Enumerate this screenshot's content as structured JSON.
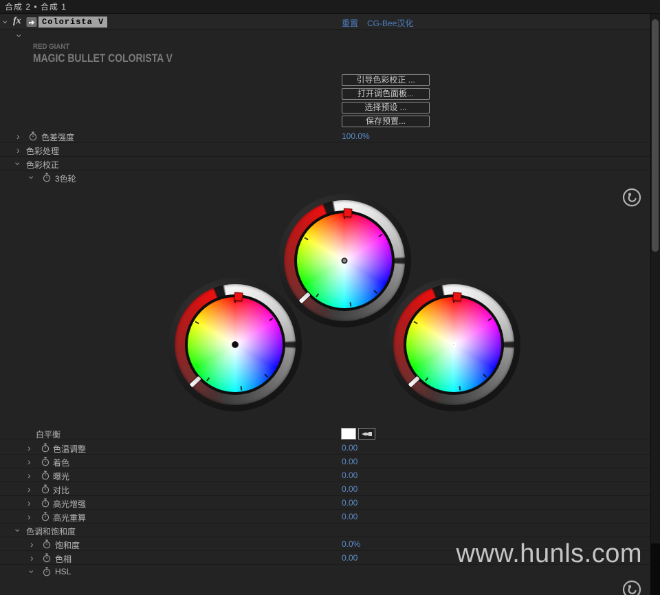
{
  "colors": {
    "accent_blue": "#5d8cc8",
    "panel_bg": "#232323",
    "wheel_arc_red": "#f01010"
  },
  "tab_bar": {
    "title": "合成 2 • 合成 1"
  },
  "effect_header": {
    "fx": "fx",
    "name": "Colorista V",
    "reset": "重置",
    "localization": "CG-Bee汉化"
  },
  "logo": {
    "brand": "RED GIANT",
    "product": "MAGIC BULLET COLORISTA V"
  },
  "buttons": {
    "guided": "引导色彩校正 ...",
    "open_panel": "打开调色面板...",
    "choose_preset": "选择预设 ...",
    "save_preset": "保存预置..."
  },
  "params": {
    "ca_strength": {
      "label": "色差强度",
      "value": "100.0%"
    },
    "color_process": {
      "label": "色彩处理"
    },
    "color_correct": {
      "label": "色彩校正"
    },
    "three_way": {
      "label": "3色轮"
    },
    "white_balance": {
      "label": "白平衡"
    },
    "temp": {
      "label": "色温调整",
      "value": "0.00"
    },
    "tint": {
      "label": "着色",
      "value": "0.00"
    },
    "exposure": {
      "label": "曝光",
      "value": "0.00"
    },
    "contrast": {
      "label": "对比",
      "value": "0.00"
    },
    "highlight_boost": {
      "label": "高光增强",
      "value": "0.00"
    },
    "highlight_recovery": {
      "label": "高光重算",
      "value": "0.00"
    },
    "hue_sat_group": {
      "label": "色调和饱和度"
    },
    "saturation": {
      "label": "饱和度",
      "value": "0.0%"
    },
    "hue": {
      "label": "色相",
      "value": "0.00"
    },
    "hsl": {
      "label": "HSL"
    }
  },
  "wheels": {
    "midtones": "midtones",
    "shadows": "shadows",
    "highlights": "highlights"
  },
  "watermark": "www.hunls.com"
}
